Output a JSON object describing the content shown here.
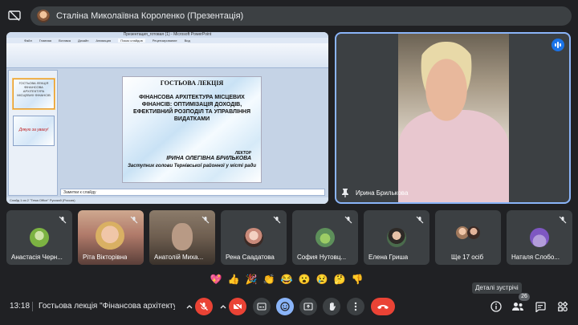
{
  "presenter": {
    "label": "Сталіна Миколаївна Короленко (Презентація)"
  },
  "screen": {
    "window_title": "Презентация_готовая (1) - Microsoft PowerPoint",
    "tabs": [
      "Файл",
      "Главная",
      "Вставка",
      "Дизайн",
      "Анимация",
      "Показ слайдов",
      "Рецензирование",
      "Вид"
    ],
    "active_tab": "Показ слайдов",
    "thumb1_lines": [
      "ГОСТЬОВА ЛЕКЦІЯ",
      "ФІНАНСОВА АРХІТЕКТУРА",
      "МІСЦЕВИХ ФІНАНСІВ"
    ],
    "thumb2_text": "Дякую за увагу!",
    "slide": {
      "heading": "ГОСТЬОВА ЛЕКЦІЯ",
      "main": "ФІНАНСОВА АРХІТЕКТУРА МІСЦЕВИХ ФІНАНСІВ: ОПТИМІЗАЦІЯ ДОХОДІВ, ЕФЕКТИВНИЙ РОЗПОДІЛ ТА УПРАВЛІННЯ ВИДАТКАМИ",
      "lector": "ЛЕКТОР",
      "speaker": "ІРИНА ОЛЕГІВНА БРИЛЬКОВА",
      "role": "Заступник голови Тернівської районної у місті ради"
    },
    "notes_placeholder": "Заметки к слайду",
    "status": "Слайд 1 из 2   \"Тема Office\"   Русский (Россия)"
  },
  "speaker_tile": {
    "name": "Ирина Брилькова"
  },
  "participants": [
    {
      "name": "Анастасія Черн...",
      "kind": "avatar",
      "color": "#7cb342"
    },
    {
      "name": "Ріта Вікторівна",
      "kind": "video",
      "color": "#b07a6a"
    },
    {
      "name": "Анатолій Миха...",
      "kind": "video",
      "color": "#6d5d4f"
    },
    {
      "name": "Рена Саадатова",
      "kind": "avatar",
      "color": "#c98a7a"
    },
    {
      "name": "София Нутовц...",
      "kind": "avatar",
      "color": "#5d8f5a"
    },
    {
      "name": "Елена Гриша",
      "kind": "avatar",
      "color": "#4a6b4c"
    },
    {
      "name": "Ще 17 осіб",
      "kind": "group",
      "color": "#a0785c"
    },
    {
      "name": "Наталя Слобо...",
      "kind": "avatar",
      "color": "#7e57c2"
    }
  ],
  "reactions": [
    "💖",
    "👍",
    "🎉",
    "👏",
    "😂",
    "😮",
    "😢",
    "🤔",
    "👎"
  ],
  "tooltip": "Деталі зустрічі",
  "bottom": {
    "time": "13:18",
    "meeting_title": "Гостьова лекція \"Фінансова архітекту...",
    "participant_count": "26"
  },
  "colors": {
    "accent": "#8ab4f8",
    "danger": "#ea4335",
    "surface": "#3c4043",
    "background": "#202124"
  }
}
